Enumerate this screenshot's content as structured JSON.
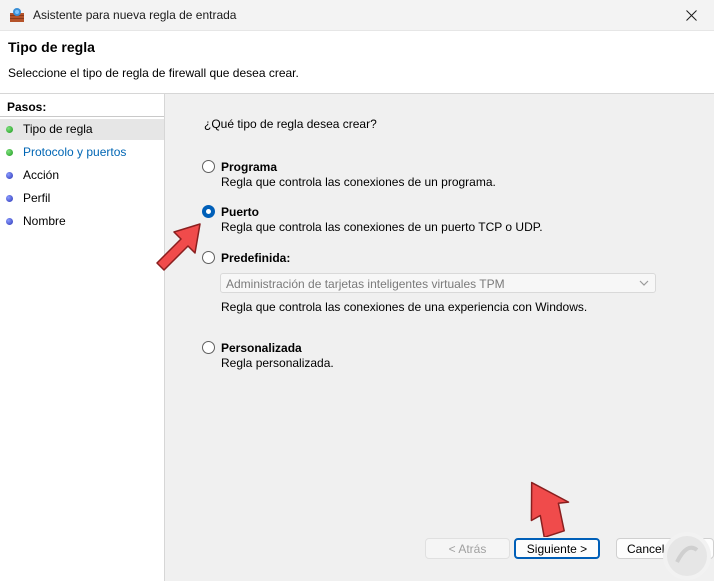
{
  "window": {
    "title": "Asistente para nueva regla de entrada",
    "app_icon": "firewall-shield-icon",
    "close_icon": "close-icon"
  },
  "header": {
    "title": "Tipo de regla",
    "description": "Seleccione el tipo de regla de firewall que desea crear."
  },
  "steps": {
    "title": "Pasos:",
    "items": [
      {
        "label": "Tipo de regla",
        "status": "green"
      },
      {
        "label": "Protocolo y puertos",
        "status": "green"
      },
      {
        "label": "Acción",
        "status": "blue"
      },
      {
        "label": "Perfil",
        "status": "blue"
      },
      {
        "label": "Nombre",
        "status": "blue"
      }
    ]
  },
  "content": {
    "question": "¿Qué tipo de regla desea crear?",
    "options": [
      {
        "title": "Programa",
        "desc": "Regla que controla las conexiones de un programa.",
        "checked": false
      },
      {
        "title": "Puerto",
        "desc": "Regla que controla las conexiones de un puerto TCP o UDP.",
        "checked": true
      },
      {
        "title": "Predefinida:",
        "desc": "Regla que controla las conexiones de una experiencia con Windows.",
        "checked": false
      },
      {
        "title": "Personalizada",
        "desc": "Regla personalizada.",
        "checked": false
      }
    ],
    "predefined_select_value": "Administración de tarjetas inteligentes virtuales TPM"
  },
  "buttons": {
    "back": "< Atrás",
    "next": "Siguiente >",
    "cancel": "Cancelar"
  },
  "colors": {
    "accent": "#005fb8",
    "annotation_arrow": "#f04b4b",
    "link": "#0066b4"
  }
}
